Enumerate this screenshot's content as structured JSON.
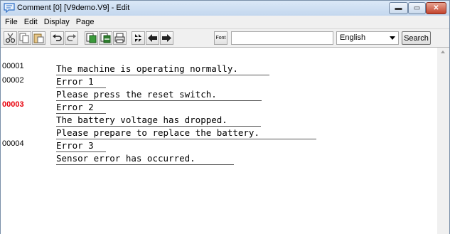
{
  "window": {
    "title": "Comment [0] [V9demo.V9] - Edit",
    "controls": {
      "minimize": "▬",
      "maximize": "▭",
      "close": "✕"
    }
  },
  "menu": [
    "File",
    "Edit",
    "Display",
    "Page"
  ],
  "toolbar": {
    "buttons": [
      "cut-icon",
      "copy-icon",
      "paste-icon",
      "undo-icon",
      "redo-icon",
      "insert-page-icon",
      "delete-page-icon",
      "print-icon",
      "rewind-icon",
      "back-arrow-icon",
      "forward-arrow-icon"
    ],
    "font_label": "Font",
    "search_text": "",
    "language": "English",
    "search_label": "Search"
  },
  "lines": [
    {
      "number": "00001",
      "text": "The machine is operating normally.",
      "active": false
    },
    {
      "number": "00002",
      "text": "Error 1",
      "active": false
    },
    {
      "number": "",
      "text": "Please press the reset switch.",
      "active": false
    },
    {
      "number": "00003",
      "text": "Error 2",
      "active": true
    },
    {
      "number": "",
      "text": "The battery voltage has dropped.",
      "active": false
    },
    {
      "number": "",
      "text": "Please prepare to replace the battery.",
      "active": false
    },
    {
      "number": "00004",
      "text": "Error 3",
      "active": false
    },
    {
      "number": "",
      "text": "Sensor error has occurred.",
      "active": false
    }
  ],
  "colors": {
    "active_line_number": "#e8000b",
    "title_bar": "#c3d7ee"
  }
}
